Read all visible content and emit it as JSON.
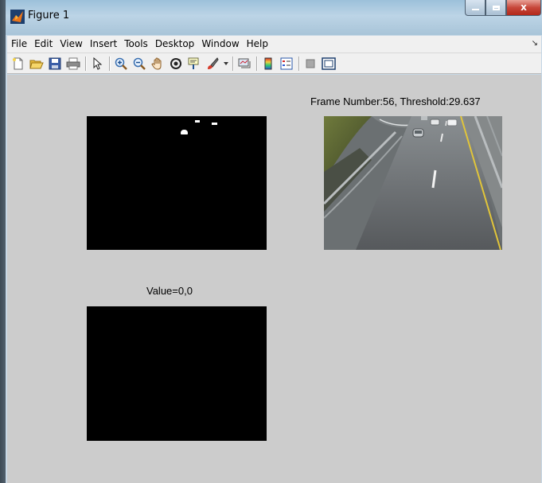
{
  "window": {
    "title": "Figure 1",
    "icon": "matlab-icon",
    "controls": {
      "minimize": "minimize-icon",
      "maximize": "maximize-icon",
      "close_label": "x"
    }
  },
  "menu": {
    "items": [
      "File",
      "Edit",
      "View",
      "Insert",
      "Tools",
      "Desktop",
      "Window",
      "Help"
    ],
    "dock_glyph": "↘"
  },
  "toolbar": {
    "buttons": [
      "new-figure-icon",
      "open-file-icon",
      "save-icon",
      "print-icon",
      "edit-plot-arrow-icon",
      "zoom-in-icon",
      "zoom-out-icon",
      "pan-hand-icon",
      "rotate-3d-icon",
      "data-cursor-icon",
      "brush-icon",
      "link-plot-icon",
      "colorbar-icon",
      "legend-icon",
      "hide-plot-tools-icon",
      "show-plot-tools-icon"
    ]
  },
  "figure": {
    "background": "#cccccc",
    "axes_top_right_title": "Frame Number:56, Threshold:29.637",
    "axes_bottom_left_title": "Value=0,0"
  },
  "colors": {
    "titlebar": "#a8c4d8",
    "menubar": "#f0f0f0",
    "close_button": "#c7473a",
    "axes_black": "#000000"
  }
}
